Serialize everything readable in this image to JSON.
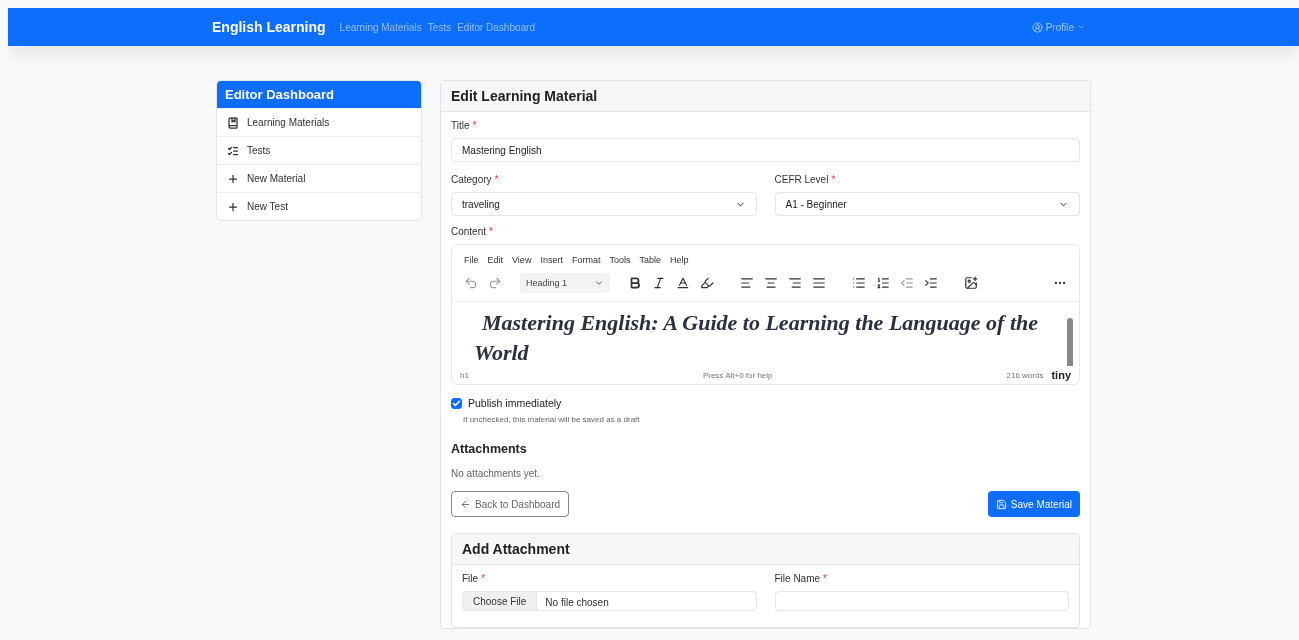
{
  "navbar": {
    "brand": "English Learning",
    "links": [
      {
        "label": "Learning Materials",
        "selected": false
      },
      {
        "label": "Tests",
        "selected": false
      },
      {
        "label": "Editor Dashboard",
        "selected": false
      }
    ],
    "profile": "Profile"
  },
  "sidebar": {
    "title": "Editor Dashboard",
    "items": [
      {
        "label": "Learning Materials",
        "kind": "book"
      },
      {
        "label": "Tests",
        "kind": "list"
      },
      {
        "label": "New Material",
        "kind": "plus"
      },
      {
        "label": "New Test",
        "kind": "plus"
      }
    ]
  },
  "form": {
    "title": "Edit Learning Material",
    "title_field": {
      "label": "Title",
      "required_mark": "*",
      "value": "Mastering English"
    },
    "category": {
      "label": "Category",
      "required_mark": "*",
      "value": "traveling"
    },
    "cefr_level": {
      "label": "CEFR Level",
      "required_mark": "*",
      "value": "A1 - Beginner"
    },
    "content": {
      "label": "Content",
      "required_mark": "*",
      "editor": {
        "menu": [
          "File",
          "Edit",
          "View",
          "Insert",
          "Format",
          "Tools",
          "Table",
          "Help"
        ],
        "block_format": "Heading 1",
        "heading": "Mastering English: A Guide to Learning the Language of the World",
        "path": "h1",
        "help": "Press Alt+0 for help",
        "word_count": "216 words",
        "brand": "tiny"
      }
    },
    "publish": {
      "label": "Publish immediately",
      "checked": true,
      "hint": "If unchecked, this material will be saved as a draft"
    },
    "attachments": {
      "heading": "Attachments",
      "empty": "No attachments yet."
    },
    "buttons": {
      "back": "Back to Dashboard",
      "save": "Save Material"
    }
  },
  "add_attachment": {
    "title": "Add Attachment",
    "file": {
      "label": "File",
      "required_mark": "*",
      "button": "Choose File",
      "status": "No file chosen"
    },
    "file_name": {
      "label": "File Name",
      "required_mark": "*"
    }
  }
}
